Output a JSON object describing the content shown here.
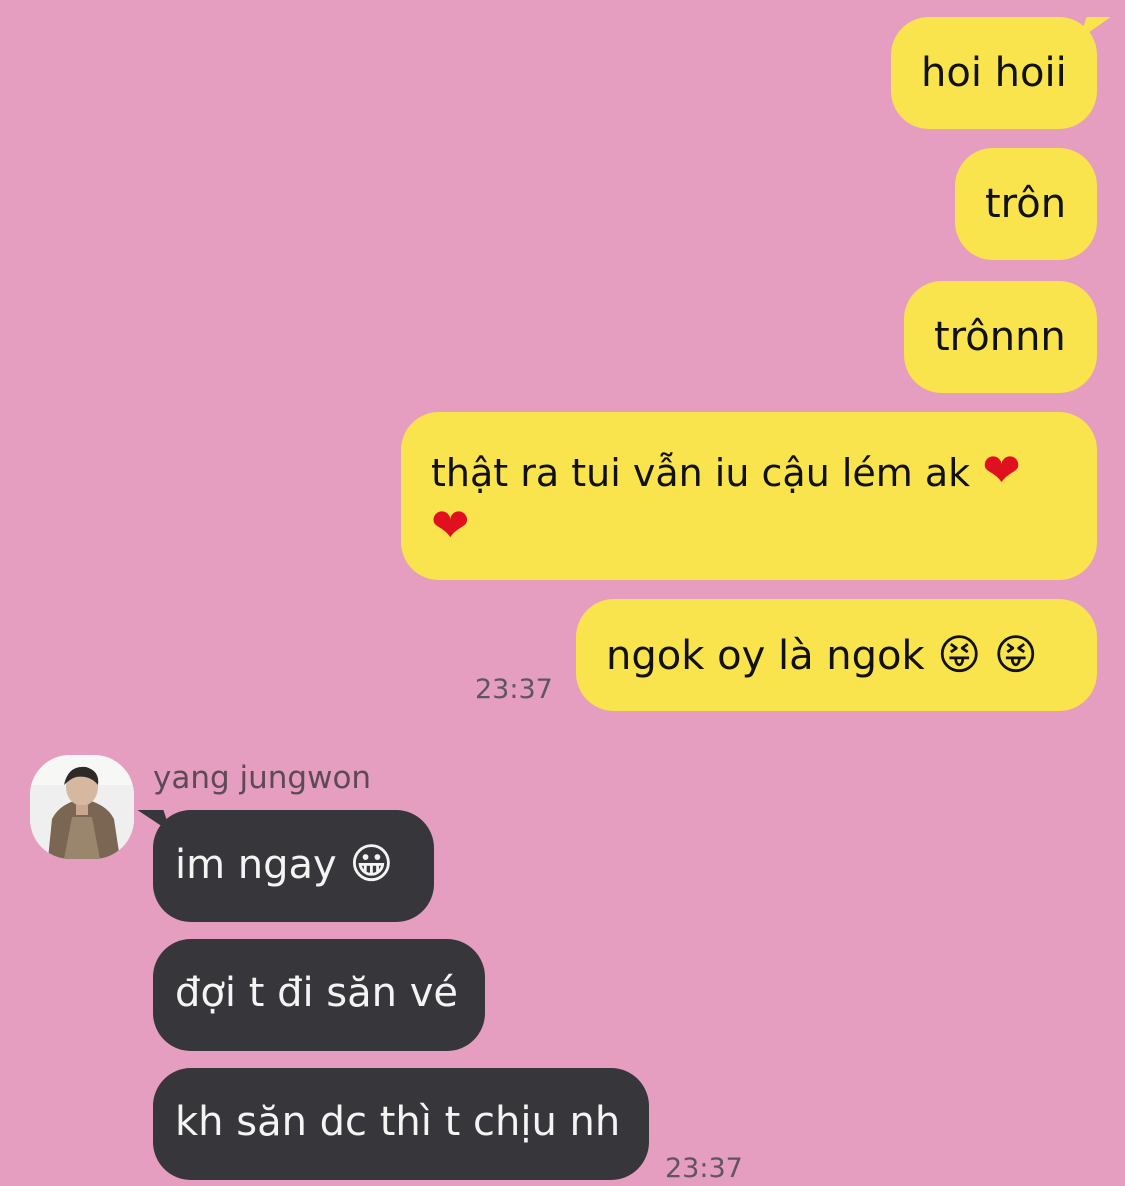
{
  "outgoing": [
    {
      "id": "m1",
      "text": "hoi hoii"
    },
    {
      "id": "m2",
      "text": "trôn"
    },
    {
      "id": "m3",
      "text": "trônnn"
    },
    {
      "id": "m4",
      "text": "thật ra tui vẫn iu cậu lém ak",
      "emoji_1": "❤",
      "emoji_2": "❤"
    },
    {
      "id": "m5",
      "text": "ngok oy là ngok",
      "emoji_1": "😝",
      "emoji_2": "😝"
    }
  ],
  "outgoing_time": "23:37",
  "incoming_sender": "yang jungwon",
  "incoming": [
    {
      "id": "r1",
      "text": "im ngay",
      "emoji": "😀"
    },
    {
      "id": "r2",
      "text": "đợi t đi săn vé"
    },
    {
      "id": "r3",
      "text": "kh săn dc thì t chịu nh"
    }
  ],
  "incoming_time": "23:37",
  "colors": {
    "background": "#e59ebf",
    "outgoing_bubble": "#f9e44d",
    "incoming_bubble": "#37363a",
    "heart": "#e0101f"
  },
  "icons": {
    "avatar": "user-avatar-photo",
    "heart": "red-heart-emoji",
    "tongue": "squinting-face-with-tongue-emoji",
    "grin": "grinning-face-emoji"
  }
}
